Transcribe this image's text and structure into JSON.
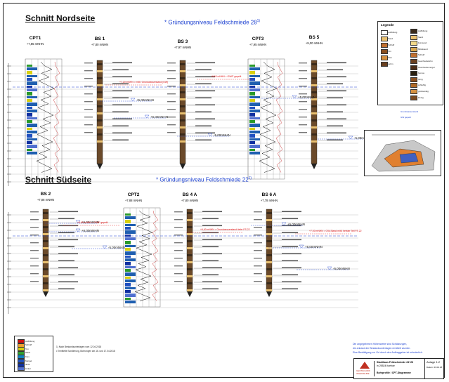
{
  "north": {
    "title": "Schnitt Nordseite",
    "subtitle": "* Gründungsniveau Feldschmiede 28",
    "subtitle_sup": "1)",
    "columns": [
      {
        "name": "CPT1",
        "elev": "+7,85 mNHN",
        "type": "cpt"
      },
      {
        "name": "BS 1",
        "elev": "+7,80 mNHN",
        "type": "bs"
      },
      {
        "name": "BS 3",
        "elev": "+7,97 mNHN",
        "type": "bs"
      },
      {
        "name": "CPT3",
        "elev": "+7,95 mNHN",
        "type": "cpt"
      },
      {
        "name": "BS 5",
        "elev": "+9,00 mNHN",
        "type": "bs"
      }
    ],
    "water_levels": [
      "+5,00mNHN",
      "+6,00mNHN",
      "-5,00mNHN",
      "+5,00mNHN",
      "-5,00mNHN"
    ],
    "red_notes": [
      "+7,20 mNHN = mittl. Grundwasserstand (GW)",
      "+6,60 mNHN = GW/F gepeilt"
    ]
  },
  "south": {
    "title": "Schnitt Südseite",
    "subtitle": "* Gründungsniveau Feldschmiede 22",
    "subtitle_sup": "1)",
    "columns": [
      {
        "name": "BS 2",
        "elev": "+7,88 mNHN",
        "type": "bs"
      },
      {
        "name": "CPT2",
        "elev": "+7,88 mNHN",
        "type": "cpt"
      },
      {
        "name": "BS 4 A",
        "elev": "+7,80 mNHN",
        "type": "bs"
      },
      {
        "name": "BS 6 A",
        "elev": "+7,78 mNHN",
        "type": "bs"
      }
    ],
    "water_levels": [
      "+5,00mNHN",
      "+6,00mNHN",
      "-5,00mNHN",
      "+5,00mNHN",
      "+6,00mNHN",
      "-5,00mNHN"
    ],
    "red_notes": [
      "+6,60 mNHN = GW/F gepeilt",
      "+6,60 mNHN = Grundwasserstand tiefer FS 22",
      "+7,00 mNHN = GW-Stand mittl. tiefster Teil FS 22"
    ]
  },
  "legend": {
    "title": "Legende",
    "items": [
      {
        "label": "Auffüllung",
        "color": "#3a2a1a"
      },
      {
        "label": "Sand",
        "color": "#e8c070"
      },
      {
        "label": "Feinsand",
        "color": "#f2d98a"
      },
      {
        "label": "Mittelsand",
        "color": "#d8a850"
      },
      {
        "label": "Schluff",
        "color": "#c07030"
      },
      {
        "label": "Geschiebelehm",
        "color": "#6a4020"
      },
      {
        "label": "Geschiebemergel",
        "color": "#4a2c16"
      },
      {
        "label": "humos",
        "color": "#2a2010"
      },
      {
        "label": "tonig",
        "color": "#8a5020"
      },
      {
        "label": "schluffig",
        "color": "#b06a28"
      },
      {
        "label": "grobsandig",
        "color": "#d49040"
      },
      {
        "label": "kiesig",
        "color": "#7a4a20"
      }
    ],
    "soil_left": [
      "Auffüllung",
      "Sand",
      "Schluff",
      "Ton",
      "Kies",
      "Lehm"
    ],
    "blue_notes": [
      "Grundwasserstand",
      "GW gepeilt"
    ]
  },
  "cpt_legend": {
    "items": [
      {
        "label": "Auffüllung",
        "color": "#d01010"
      },
      {
        "label": "Schluff",
        "color": "#f0a030"
      },
      {
        "label": "Ton",
        "color": "#d8d010"
      },
      {
        "label": "Sand",
        "color": "#30a030"
      },
      {
        "label": "Kies",
        "color": "#1080c0"
      },
      {
        "label": "Mergel",
        "color": "#2050c0"
      },
      {
        "label": "dicht",
        "color": "#1030a0"
      },
      {
        "label": "locker",
        "color": "#5070d0"
      }
    ]
  },
  "notes": {
    "left1": "1) Nach Bestandsunterlagen vom 12.04.2018",
    "left2": "• Ermittelte Sondierung, Bohrungen am 16. und 17.04.2018",
    "blue1": "Die angegebenen Höhenwerte sind Schätzungen,",
    "blue2": "die anhand der Bestandsunterlagen ermittelt wurden.",
    "blue3": "Eine Bestätigung vor Ort durch den Auftraggeber ist erforderlich."
  },
  "title_block": {
    "firm1": "GEOTECHNIK",
    "firm2": "INGENIEURE",
    "project1": "Stadthaus Feldschmiede 24+26",
    "project2": "in 25524 Itzehoe",
    "drawing": "Bohrprofile / CPT-Diagramme",
    "attach": "Anlage 1.2",
    "attach_sub": "Datum: 23.04.18"
  },
  "colors": {
    "water_blue": "#1a3fd0",
    "red_note": "#e01010",
    "fill_brown": "#6b4a2a",
    "cpt_blue": "#1f5fb0",
    "cpt_green": "#2a9a2a"
  }
}
